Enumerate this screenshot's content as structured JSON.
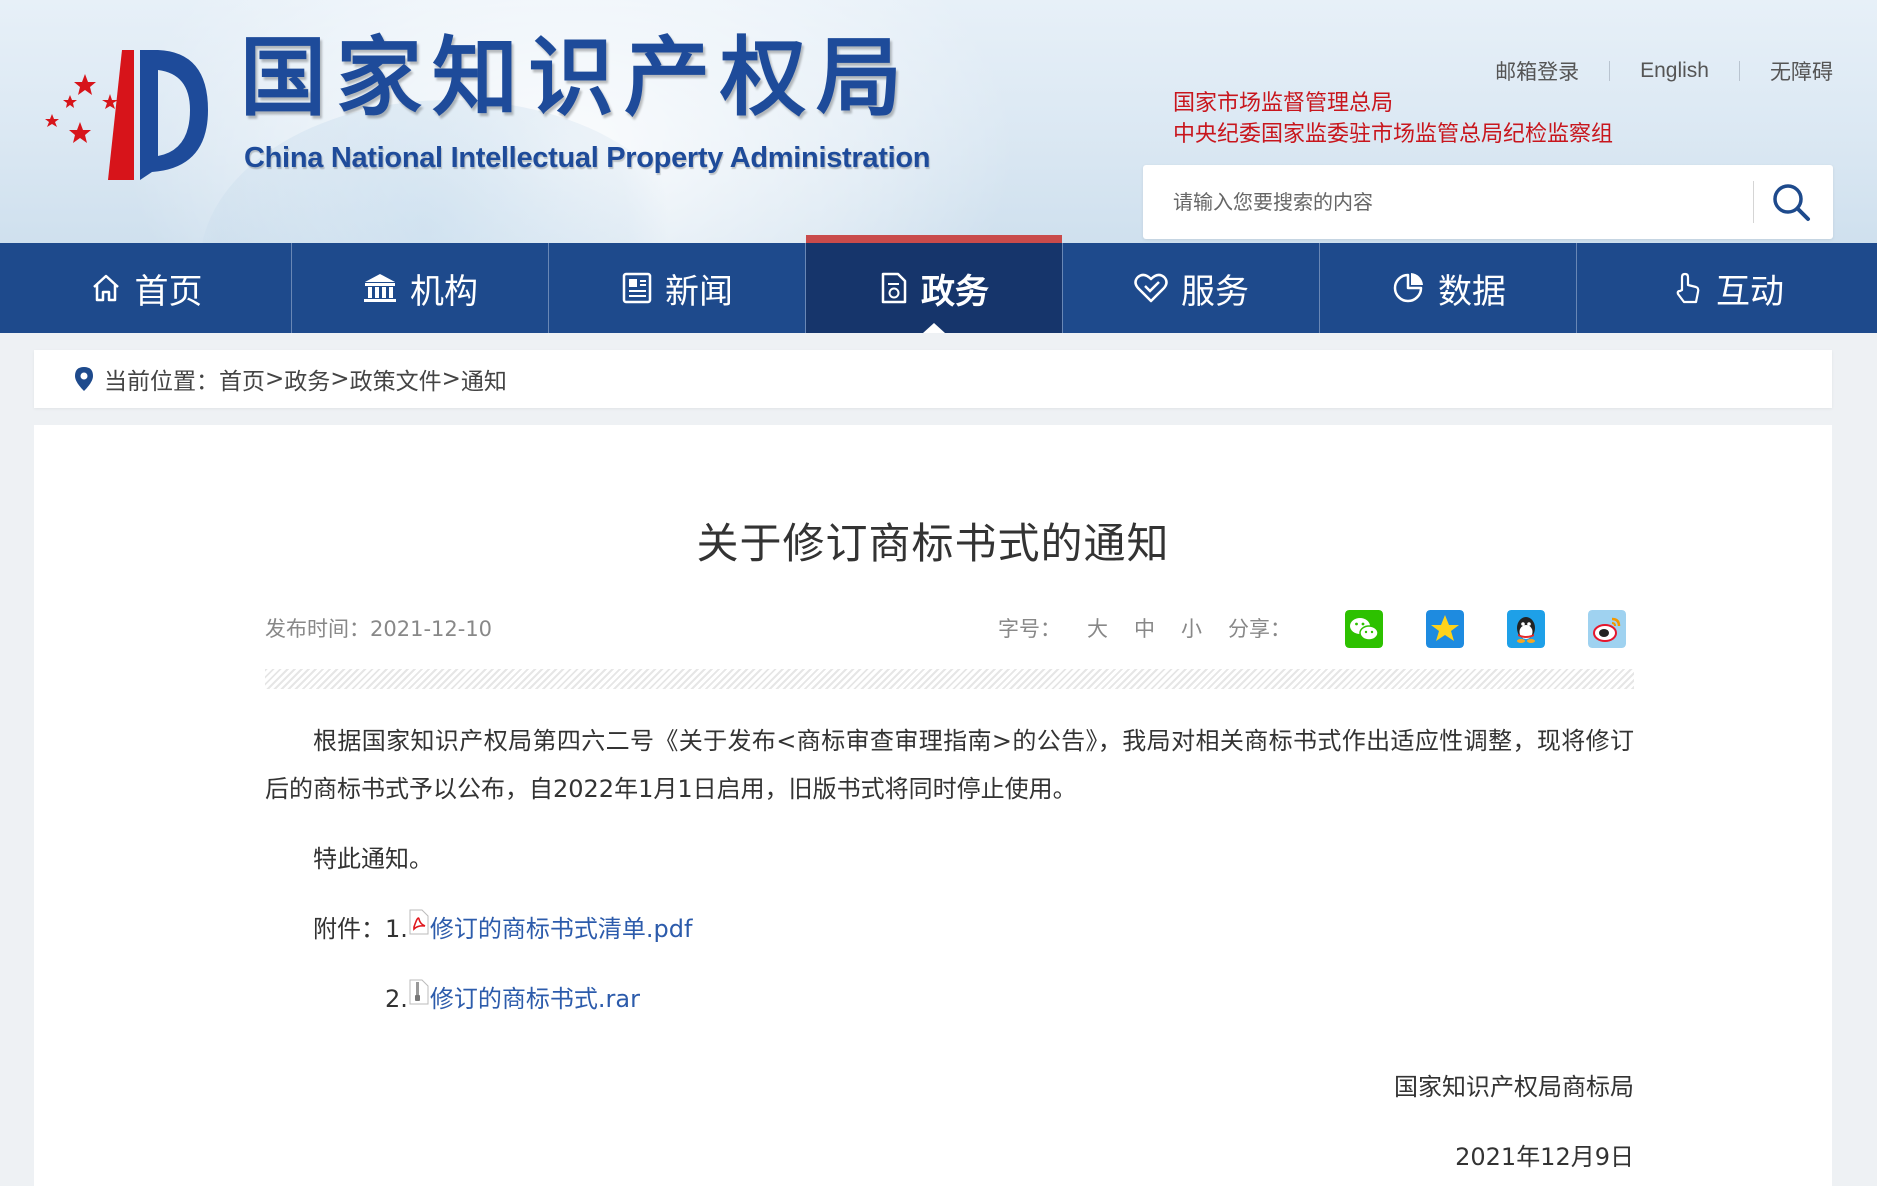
{
  "header": {
    "site_title_cn": "国家知识产权局",
    "site_title_en": "China National Intellectual Property Administration",
    "top_links": [
      "邮箱登录",
      "English",
      "无障碍"
    ],
    "org_links": [
      "国家市场监督管理总局",
      "中央纪委国家监委驻市场监管总局纪检监察组"
    ],
    "search": {
      "placeholder": "请输入您要搜索的内容"
    }
  },
  "nav": {
    "items": [
      {
        "label": "首页",
        "icon": "home-icon"
      },
      {
        "label": "机构",
        "icon": "institution-icon"
      },
      {
        "label": "新闻",
        "icon": "news-icon"
      },
      {
        "label": "政务",
        "icon": "document-icon",
        "active": true
      },
      {
        "label": "服务",
        "icon": "service-icon"
      },
      {
        "label": "数据",
        "icon": "data-icon"
      },
      {
        "label": "互动",
        "icon": "interact-icon"
      }
    ]
  },
  "breadcrumb": {
    "prefix": "当前位置：",
    "items": [
      "首页",
      "政务",
      "政策文件",
      "通知"
    ],
    "separator": ">"
  },
  "article": {
    "title": "关于修订商标书式的通知",
    "publish_label": "发布时间：2021-12-10",
    "font_size_label": "字号：",
    "font_sizes": [
      "大",
      "中",
      "小"
    ],
    "share_label": "分享：",
    "share_targets": [
      "wechat-icon",
      "qzone-icon",
      "qq-icon",
      "weibo-icon"
    ],
    "paragraph": "根据国家知识产权局第四六二号《关于发布<商标审查审理指南>的公告》，我局对相关商标书式作出适应性调整，现将修订后的商标书式予以公布，自2022年1月1日启用，旧版书式将同时停止使用。",
    "notice": "特此通知。",
    "attachment_label": "附件：",
    "attachments": [
      {
        "index": "1.",
        "name": "修订的商标书式清单.pdf",
        "icon": "pdf-file-icon"
      },
      {
        "index": "2.",
        "name": "修订的商标书式.rar",
        "icon": "archive-file-icon"
      }
    ],
    "signature": "国家知识产权局商标局",
    "sign_date": "2021年12月9日"
  },
  "colors": {
    "nav": "#1e4a8c",
    "nav_active": "#16356b",
    "accent_red": "#c8161d",
    "link": "#2c5bab"
  }
}
